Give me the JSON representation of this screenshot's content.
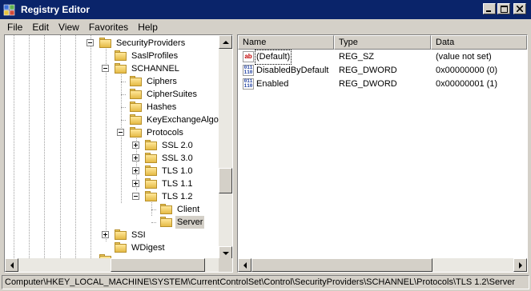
{
  "window": {
    "title": "Registry Editor"
  },
  "menu": [
    "File",
    "Edit",
    "View",
    "Favorites",
    "Help"
  ],
  "tree": {
    "items": [
      {
        "label": "SecurityProviders"
      },
      {
        "label": "SaslProfiles"
      },
      {
        "label": "SCHANNEL"
      },
      {
        "label": "Ciphers"
      },
      {
        "label": "CipherSuites"
      },
      {
        "label": "Hashes"
      },
      {
        "label": "KeyExchangeAlgori"
      },
      {
        "label": "Protocols"
      },
      {
        "label": "SSL 2.0"
      },
      {
        "label": "SSL 3.0"
      },
      {
        "label": "TLS 1.0"
      },
      {
        "label": "TLS 1.1"
      },
      {
        "label": "TLS 1.2"
      },
      {
        "label": "Client"
      },
      {
        "label": "Server",
        "selected": true
      },
      {
        "label": "SSI"
      },
      {
        "label": "WDigest"
      }
    ]
  },
  "values": {
    "columns": [
      "Name",
      "Type",
      "Data"
    ],
    "rows": [
      {
        "name": "(Default)",
        "type": "REG_SZ",
        "data": "(value not set)",
        "icon": "string-value-icon"
      },
      {
        "name": "DisabledByDefault",
        "type": "REG_DWORD",
        "data": "0x00000000 (0)",
        "icon": "dword-value-icon"
      },
      {
        "name": "Enabled",
        "type": "REG_DWORD",
        "data": "0x00000001 (1)",
        "icon": "dword-value-icon"
      }
    ]
  },
  "status": {
    "path": "Computer\\HKEY_LOCAL_MACHINE\\SYSTEM\\CurrentControlSet\\Control\\SecurityProviders\\SCHANNEL\\Protocols\\TLS 1.2\\Server"
  }
}
